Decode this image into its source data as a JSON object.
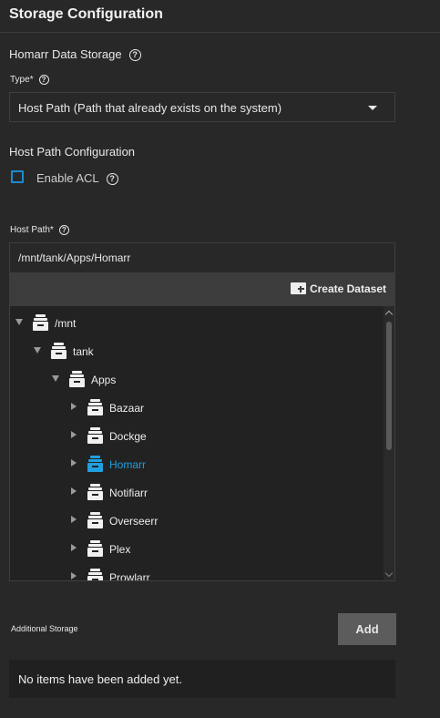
{
  "header": {
    "title": "Storage Configuration"
  },
  "data_storage": {
    "label": "Homarr Data Storage",
    "help_icon": "help-circle-icon"
  },
  "type_field": {
    "label": "Type",
    "required_mark": "*",
    "value": "Host Path (Path that already exists on the system)"
  },
  "host_path_config": {
    "label": "Host Path Configuration",
    "enable_acl_label": "Enable ACL",
    "enable_acl_checked": false
  },
  "host_path": {
    "label": "Host Path",
    "required_mark": "*",
    "value": "/mnt/tank/Apps/Homarr",
    "create_dataset_label": "Create Dataset"
  },
  "tree": [
    {
      "label": "/mnt",
      "depth": 0,
      "expanded": true,
      "active": false
    },
    {
      "label": "tank",
      "depth": 1,
      "expanded": true,
      "active": false
    },
    {
      "label": "Apps",
      "depth": 2,
      "expanded": true,
      "active": false
    },
    {
      "label": "Bazaar",
      "depth": 3,
      "expanded": false,
      "active": false
    },
    {
      "label": "Dockge",
      "depth": 3,
      "expanded": false,
      "active": false
    },
    {
      "label": "Homarr",
      "depth": 3,
      "expanded": false,
      "active": true
    },
    {
      "label": "Notifiarr",
      "depth": 3,
      "expanded": false,
      "active": false
    },
    {
      "label": "Overseerr",
      "depth": 3,
      "expanded": false,
      "active": false
    },
    {
      "label": "Plex",
      "depth": 3,
      "expanded": false,
      "active": false
    },
    {
      "label": "Prowlarr",
      "depth": 3,
      "expanded": false,
      "active": false
    }
  ],
  "additional_storage": {
    "label": "Additional Storage",
    "add_label": "Add",
    "empty_text": "No items have been added yet."
  },
  "colors": {
    "accent": "#1a8bd0",
    "active_node": "#1fa0e0",
    "background": "#282828"
  }
}
